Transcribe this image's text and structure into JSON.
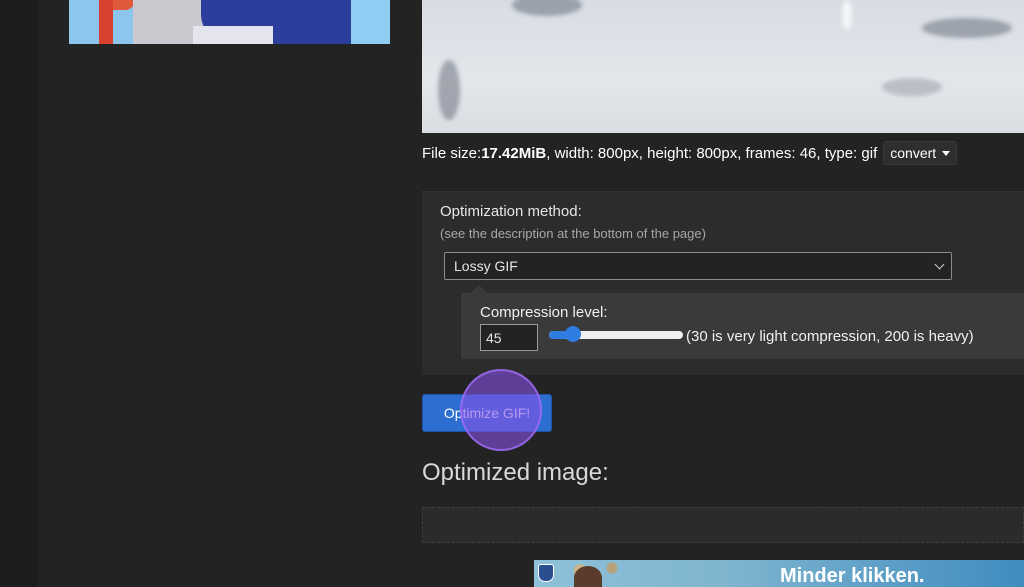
{
  "file_info": {
    "prefix": "File size: ",
    "size": "17.42MiB",
    "details": ", width: 800px, height: 800px, frames: 46, type: gif",
    "convert_label": "convert"
  },
  "optimization": {
    "title": "Optimization method:",
    "subtitle": "(see the description at the bottom of the page)",
    "method_selected": "Lossy GIF",
    "compression_label": "Compression level:",
    "compression_value": "45",
    "compression_hint": "(30 is very light compression, 200 is heavy)",
    "slider_min": 30,
    "slider_max": 200,
    "slider_value": 45
  },
  "actions": {
    "optimize_label": "Optimize GIF!"
  },
  "result": {
    "heading": "Optimized image:"
  },
  "ad": {
    "text": "Minder klikken."
  },
  "colors": {
    "accent": "#2d6fd0",
    "click_indicator": "#8552e6"
  }
}
